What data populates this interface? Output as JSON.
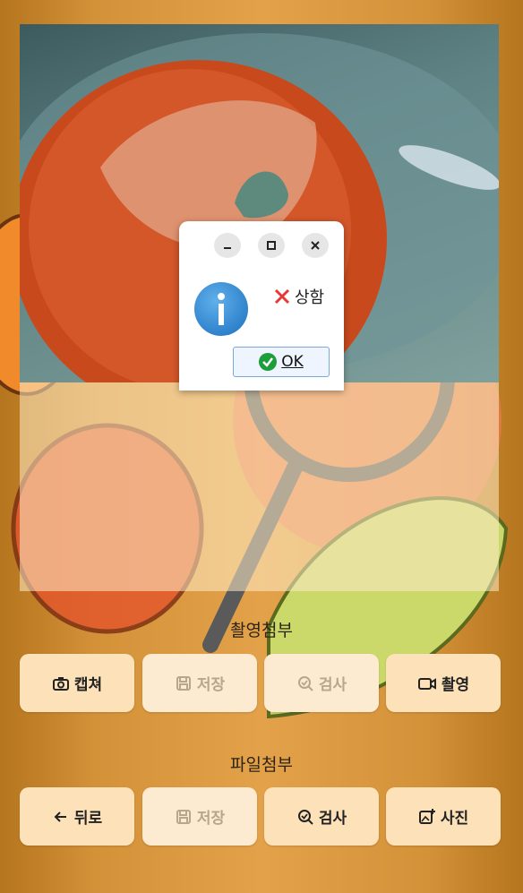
{
  "dialog": {
    "message": "상함",
    "ok_label": "OK",
    "minimize_icon": "minimize-icon",
    "maximize_icon": "maximize-icon",
    "close_icon": "close-icon",
    "info_icon": "info-icon"
  },
  "capture_section": {
    "title": "촬영첨부",
    "buttons": [
      {
        "label": "캡쳐",
        "icon": "camera-icon",
        "enabled": true
      },
      {
        "label": "저장",
        "icon": "save-icon",
        "enabled": false
      },
      {
        "label": "검사",
        "icon": "search-check-icon",
        "enabled": false
      },
      {
        "label": "촬영",
        "icon": "video-icon",
        "enabled": true
      }
    ]
  },
  "file_section": {
    "title": "파일첨부",
    "buttons": [
      {
        "label": "뒤로",
        "icon": "arrow-left-icon",
        "enabled": true
      },
      {
        "label": "저장",
        "icon": "save-icon",
        "enabled": false
      },
      {
        "label": "검사",
        "icon": "search-check-icon",
        "enabled": true
      },
      {
        "label": "사진",
        "icon": "image-add-icon",
        "enabled": true
      }
    ]
  },
  "colors": {
    "background": "#d39138",
    "button_enabled": "#fde2b9",
    "button_disabled": "#fcebd0",
    "close_x": "#e53935",
    "ok_check": "#1e9e3a",
    "info_blue": "#1c6fbf"
  }
}
